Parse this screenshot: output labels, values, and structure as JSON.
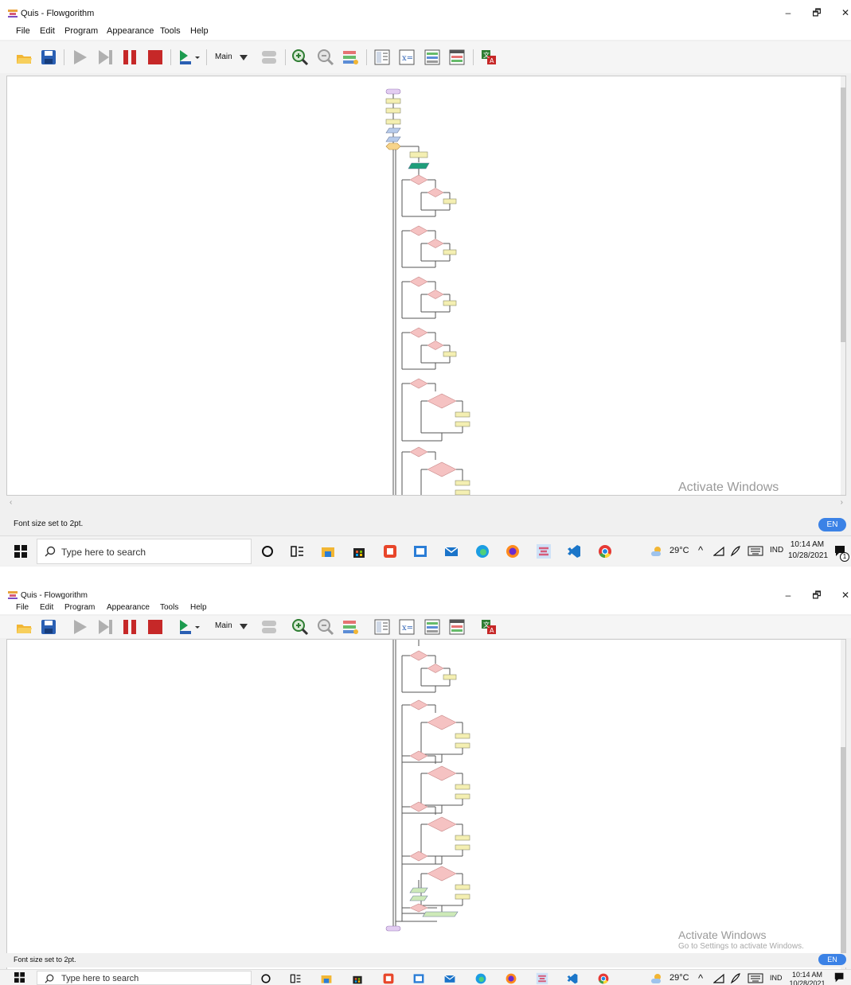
{
  "window": {
    "title": "Quis - Flowgorithm",
    "minimize": "–",
    "maximize": "🗗",
    "close": "✕"
  },
  "menu": {
    "items": [
      "File",
      "Edit",
      "Program",
      "Appearance",
      "Tools",
      "Help"
    ]
  },
  "toolbar": {
    "function_select": "Main"
  },
  "watermark": {
    "title": "Activate Windows",
    "subtitle": "Go to Settings to activate Windows."
  },
  "status": {
    "message": "Font size set to 2pt.",
    "language": "EN"
  },
  "taskbar": {
    "search_placeholder": "Type here to search",
    "weather": "29°C",
    "keyboard_lang": "IND",
    "time": "10:14 AM",
    "date": "10/28/2021",
    "notification_count": "1"
  },
  "colors": {
    "start_shape": "#e3cdf2",
    "assign_shape": "#f4efb2",
    "input_shape": "#b7cbea",
    "output_shape": "#1e9e7a",
    "if_shape": "#f5c2c2",
    "for_shape": "#f7d48a",
    "call_shape": "#cde9b8",
    "accent": "#3b82e6"
  }
}
